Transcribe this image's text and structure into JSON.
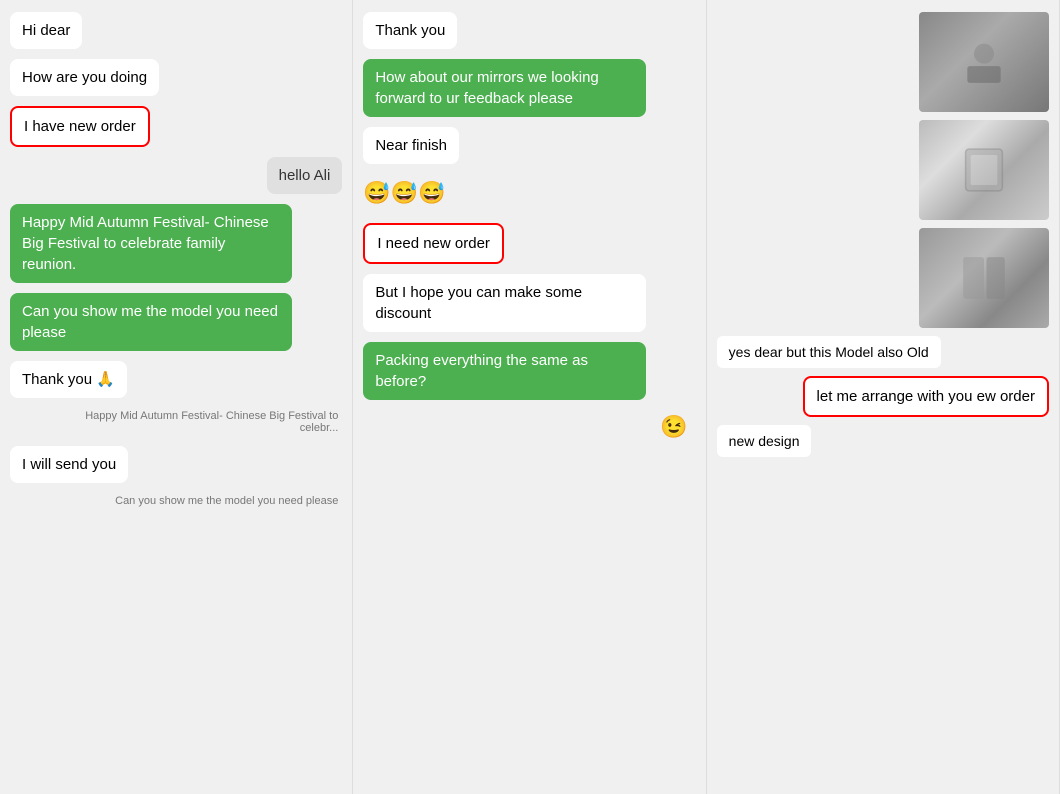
{
  "col1": {
    "messages": [
      {
        "id": "hi-dear",
        "text": "Hi dear",
        "type": "white",
        "side": "left"
      },
      {
        "id": "how-are-you",
        "text": "How are you doing",
        "type": "white",
        "side": "left"
      },
      {
        "id": "i-have-new-order",
        "text": "I have new order",
        "type": "highlighted",
        "side": "left"
      },
      {
        "id": "hello-ali",
        "text": "hello Ali",
        "type": "gray-right",
        "side": "right"
      },
      {
        "id": "happy-festival",
        "text": "Happy Mid Autumn Festival- Chinese Big Festival to celebrate family reunion.",
        "type": "green",
        "side": "left"
      },
      {
        "id": "show-model",
        "text": "Can you show me the model you need please",
        "type": "green",
        "side": "left"
      },
      {
        "id": "thank-you-pray",
        "text": "Thank you 🙏",
        "type": "white",
        "side": "left"
      },
      {
        "id": "reply-festival",
        "text": "Happy Mid Autumn Festival- Chinese Big Festival to celebr...",
        "type": "reply",
        "side": "right"
      },
      {
        "id": "i-will-send",
        "text": "I will send you",
        "type": "white",
        "side": "left"
      },
      {
        "id": "reply-show",
        "text": "Can you show me the model you need please",
        "type": "reply",
        "side": "right"
      }
    ]
  },
  "col2": {
    "messages": [
      {
        "id": "thank-you",
        "text": "Thank you",
        "type": "white",
        "side": "left"
      },
      {
        "id": "mirrors-feedback",
        "text": "How about our mirrors we looking forward to ur feedback please",
        "type": "green",
        "side": "left"
      },
      {
        "id": "near-finish",
        "text": "Near finish",
        "type": "white",
        "side": "left"
      },
      {
        "id": "emoji",
        "text": "😅😅😅",
        "type": "emoji",
        "side": "left"
      },
      {
        "id": "need-new-order",
        "text": "I need new order",
        "type": "highlighted",
        "side": "left"
      },
      {
        "id": "hope-discount",
        "text": "But I hope you can make some discount",
        "type": "white",
        "side": "left"
      },
      {
        "id": "packing-same",
        "text": "Packing everything the same as before?",
        "type": "green",
        "side": "left"
      },
      {
        "id": "emoji-bottom",
        "text": "😉",
        "type": "emoji-icon",
        "side": "right"
      }
    ]
  },
  "col3": {
    "messages": [
      {
        "id": "yes-dear",
        "text": "yes dear but this Model also Old",
        "type": "white",
        "side": "left"
      },
      {
        "id": "arrange-order",
        "text": "let me arrange with you ew order",
        "type": "highlighted-right",
        "side": "right"
      },
      {
        "id": "new-design",
        "text": "new design",
        "type": "white",
        "side": "left"
      }
    ]
  }
}
